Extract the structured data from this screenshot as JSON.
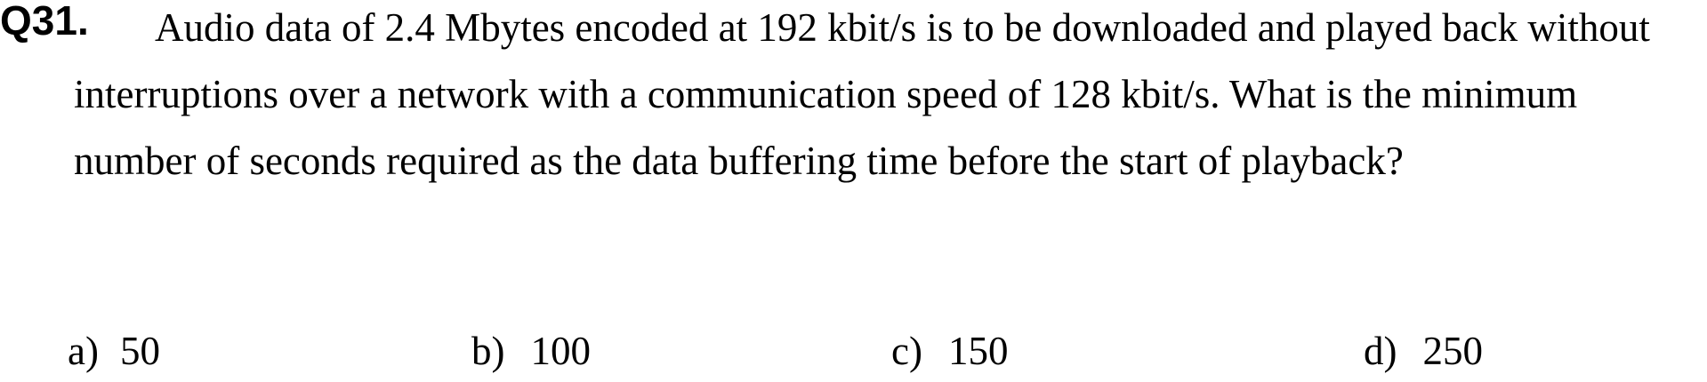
{
  "question": {
    "number": "Q31.",
    "text": "Audio data of 2.4 Mbytes encoded at 192 kbit/s is to be downloaded and played back without interruptions over a network with a communication speed of 128 kbit/s. What is the minimum number of seconds required as the data buffering time before the start of playback?"
  },
  "options": [
    {
      "label": "a)",
      "value": "50"
    },
    {
      "label": "b)",
      "value": "100"
    },
    {
      "label": "c)",
      "value": "150"
    },
    {
      "label": "d)",
      "value": "250"
    }
  ]
}
